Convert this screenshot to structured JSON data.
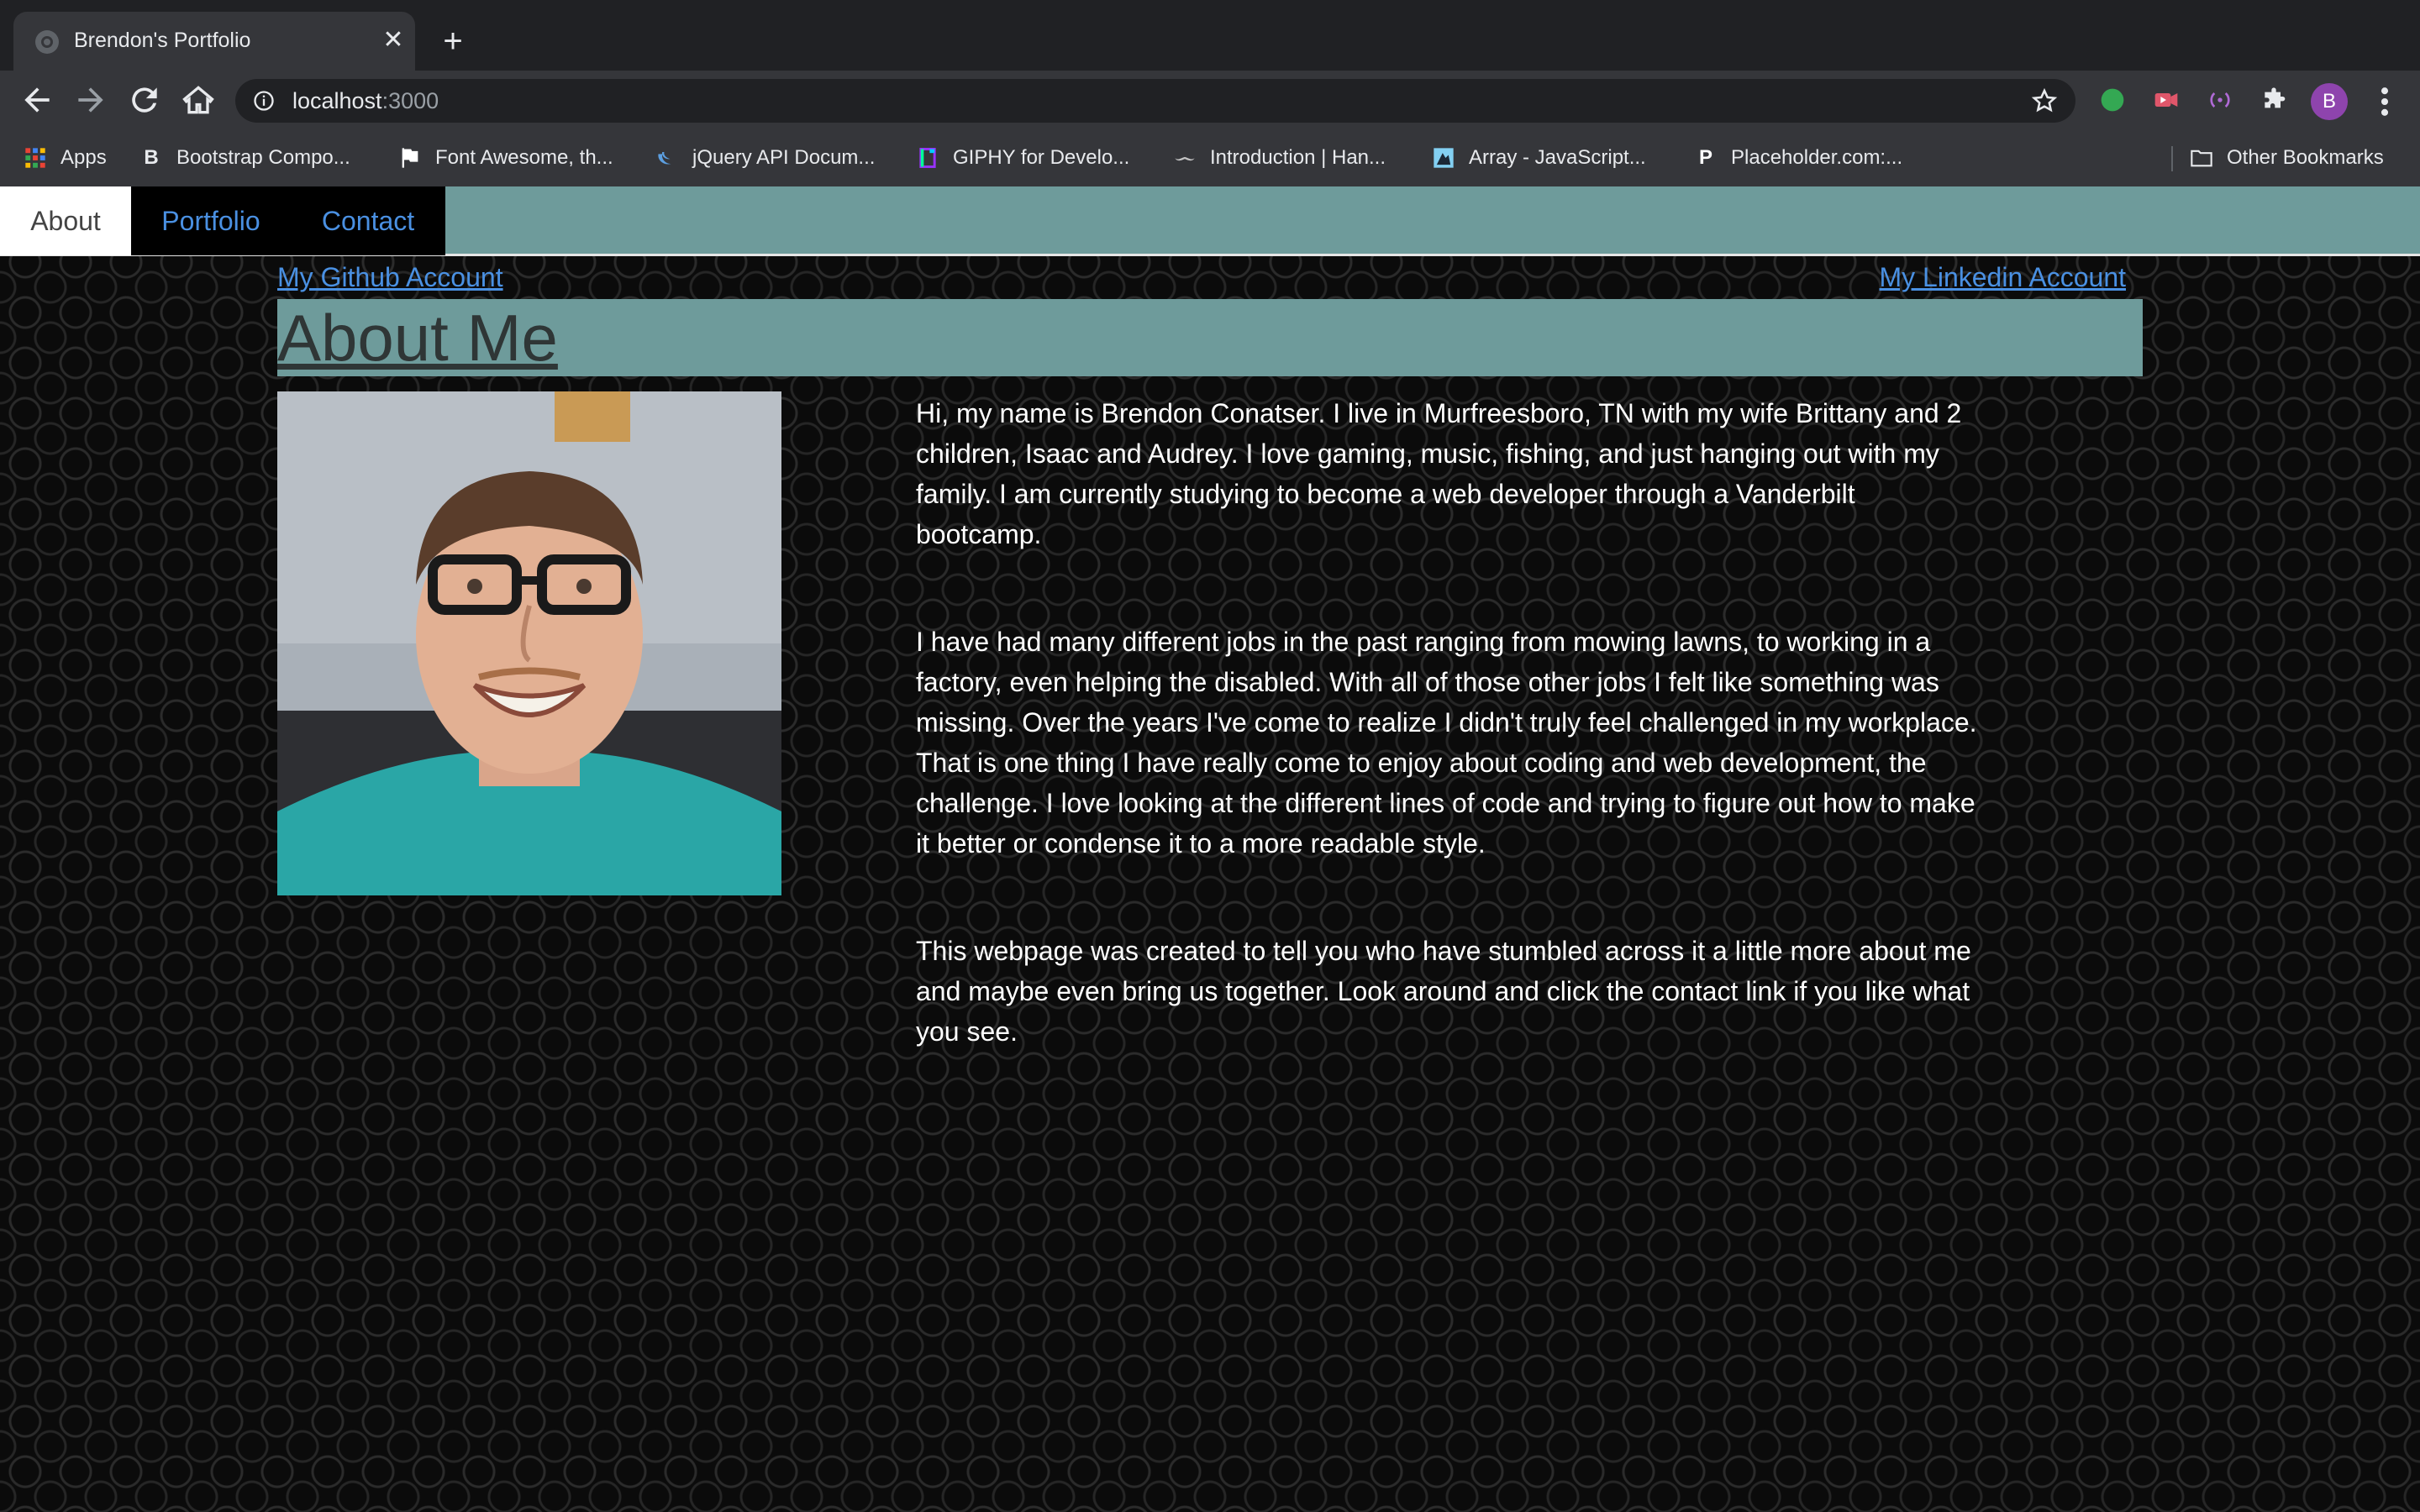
{
  "browser": {
    "tab_title": "Brendon's Portfolio",
    "url_host": "localhost",
    "url_port": ":3000",
    "profile_initial": "B",
    "bookmarks": [
      {
        "label": "Apps",
        "icon": "apps-grid-icon"
      },
      {
        "label": "Bootstrap Compo...",
        "icon": "bootstrap-icon"
      },
      {
        "label": "Font Awesome, th...",
        "icon": "flag-icon"
      },
      {
        "label": "jQuery API Docum...",
        "icon": "jquery-icon"
      },
      {
        "label": "GIPHY for Develo...",
        "icon": "giphy-icon"
      },
      {
        "label": "Introduction | Han...",
        "icon": "handlebars-icon"
      },
      {
        "label": "Array - JavaScript...",
        "icon": "mdn-icon"
      },
      {
        "label": "Placeholder.com:...",
        "icon": "placeholder-p-icon"
      }
    ],
    "other_bookmarks": "Other Bookmarks"
  },
  "nav": {
    "tabs": [
      "About",
      "Portfolio",
      "Contact"
    ],
    "active": "About"
  },
  "links": {
    "github": "My Github Account",
    "linkedin": "My Linkedin Account"
  },
  "about": {
    "heading": "About Me",
    "paragraphs": [
      "Hi, my name is Brendon Conatser. I live in Murfreesboro, TN with my wife Brittany and 2 children, Isaac and Audrey. I love gaming, music, fishing, and just hanging out with my family. I am currently studying to become a web developer through a Vanderbilt bootcamp.",
      "I have had many different jobs in the past ranging from mowing lawns, to working in a factory, even helping the disabled. With all of those other jobs I felt like something was missing. Over the years I've come to realize I didn't truly feel challenged in my workplace. That is one thing I have really come to enjoy about coding and web development, the challenge. I love looking at the different lines of code and trying to figure out how to make it better or condense it to a more readable style.",
      "This webpage was created to tell you who have stumbled across it a little more about me and maybe even bring us together. Look around and click the contact link if you like what you see."
    ]
  },
  "colors": {
    "nav_band": "#6e9b9b",
    "link": "#4a90e2"
  }
}
